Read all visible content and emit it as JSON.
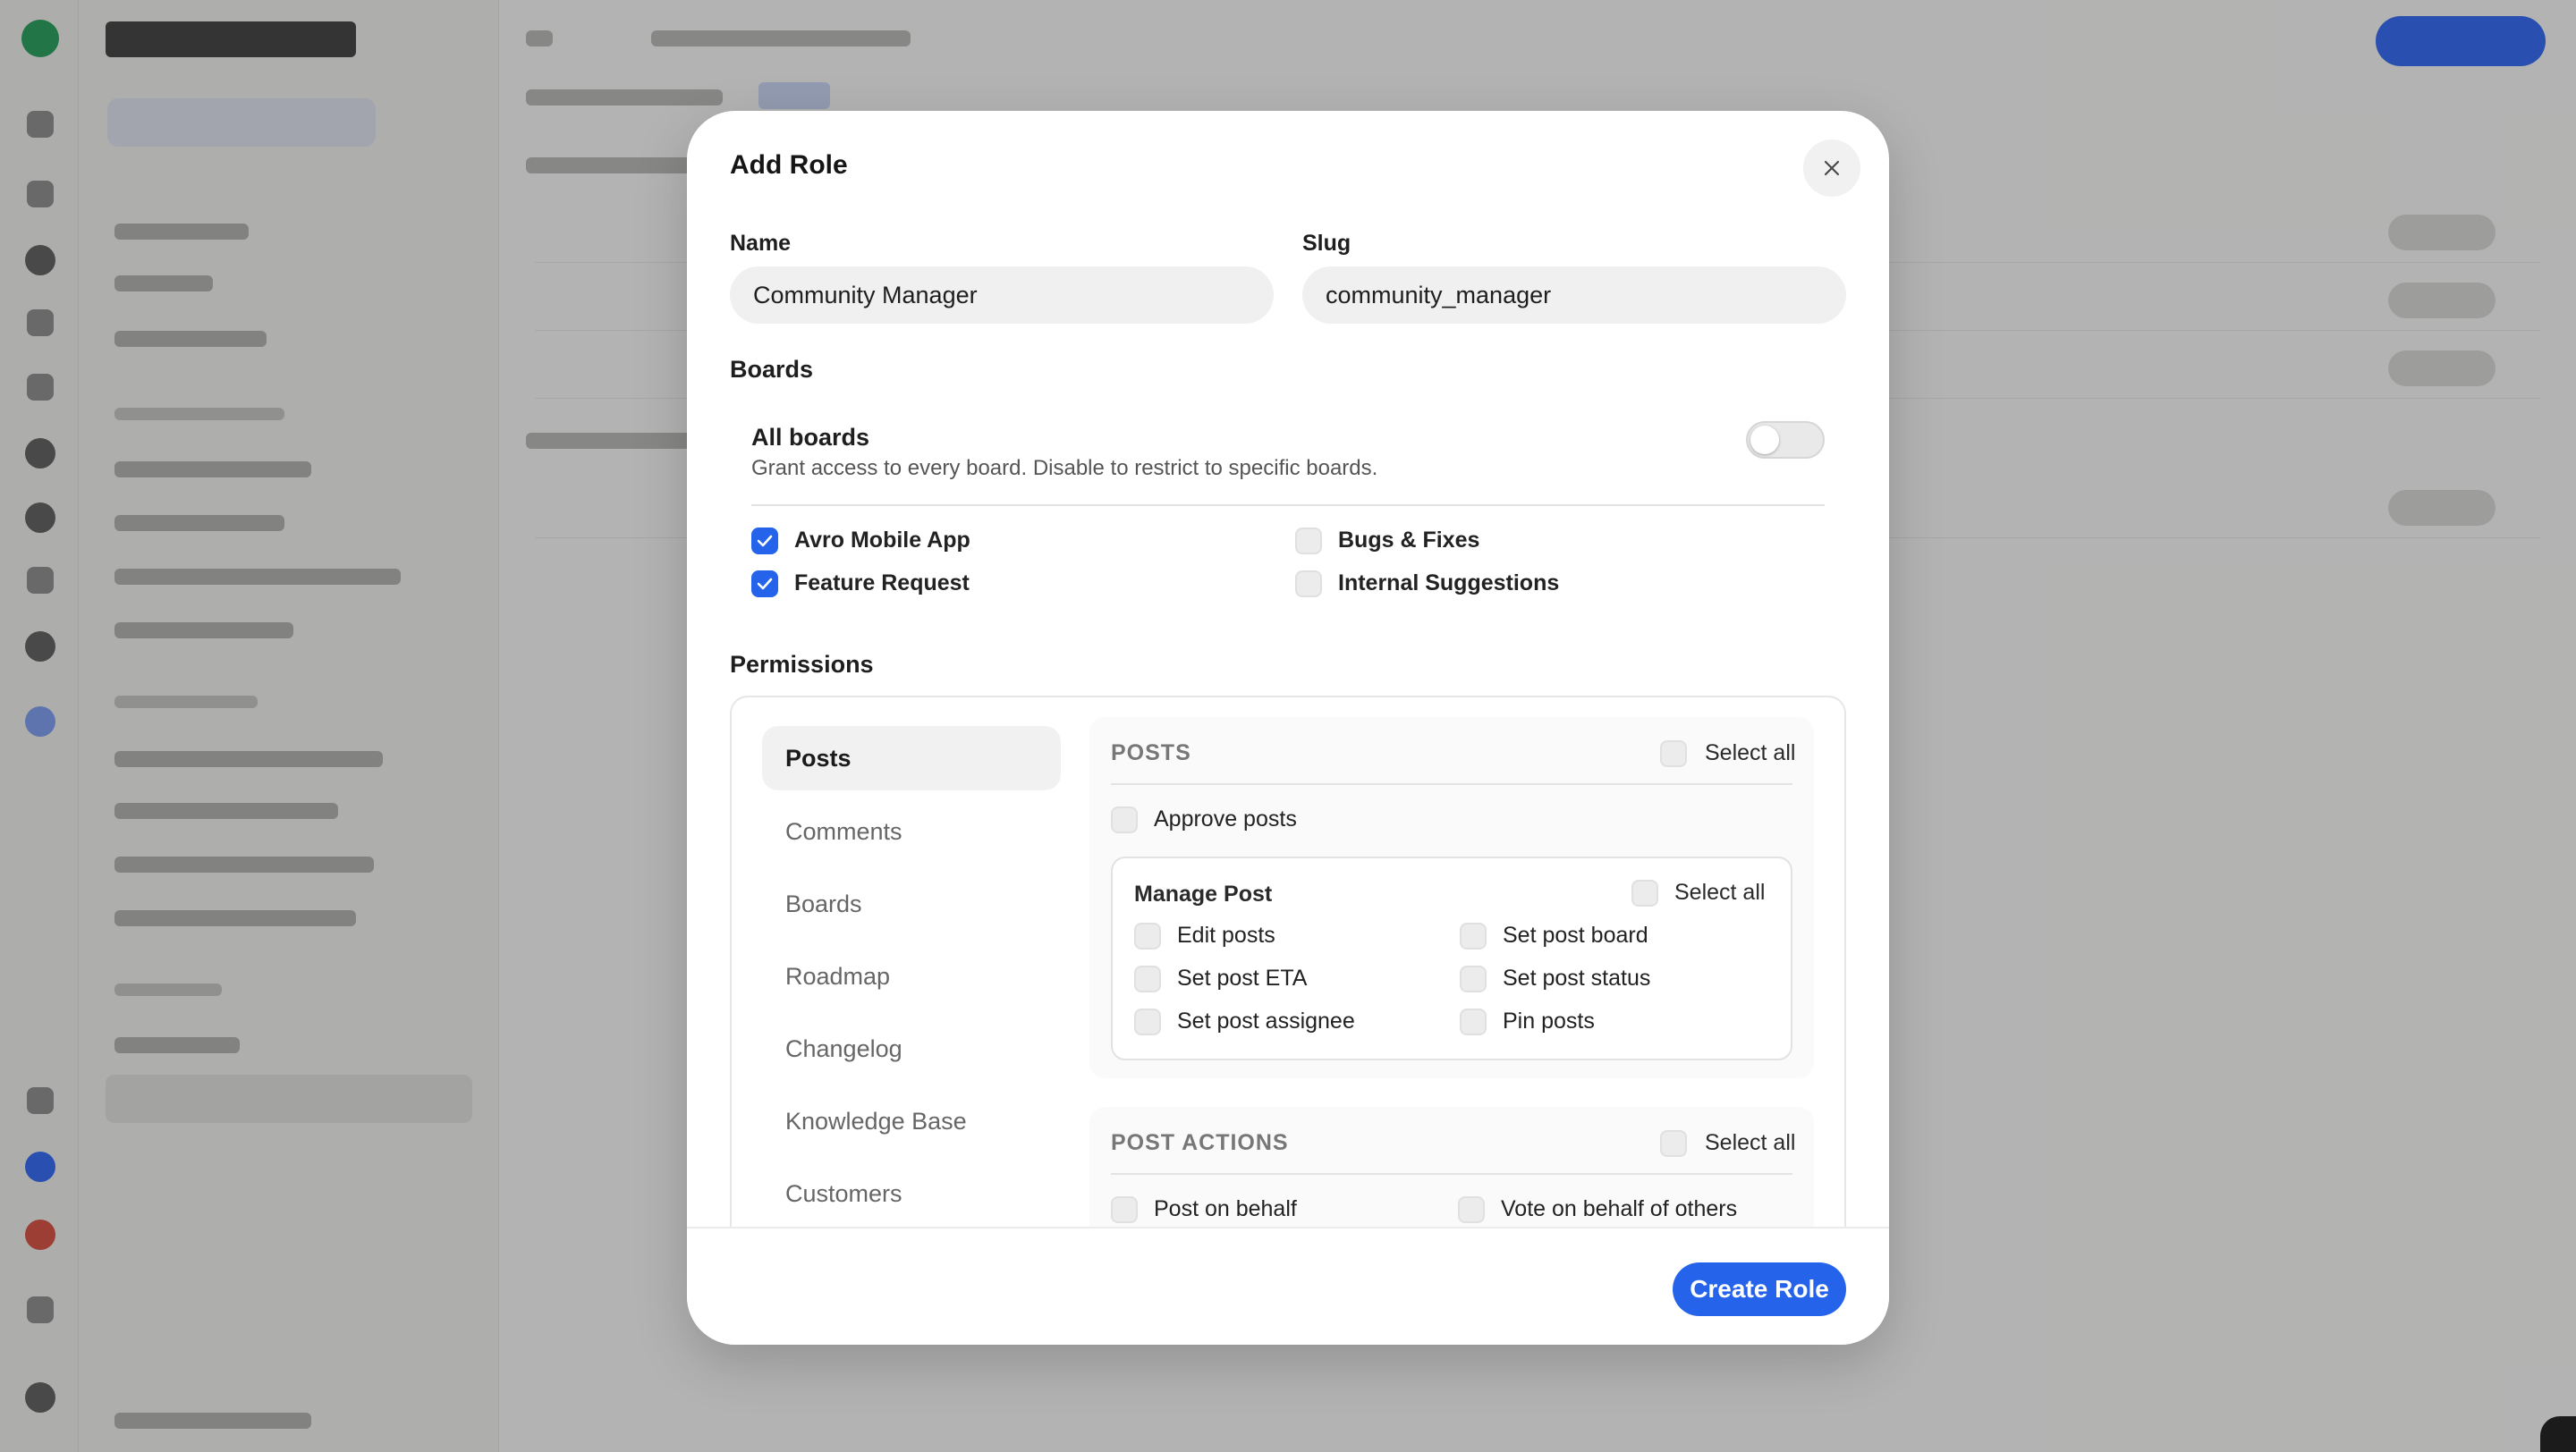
{
  "modal": {
    "title": "Add Role",
    "close_icon": "close-icon",
    "name_label": "Name",
    "name_value": "Community Manager",
    "slug_label": "Slug",
    "slug_value": "community_manager",
    "boards_label": "Boards",
    "all_boards": {
      "title": "All boards",
      "description": "Grant access to every board. Disable to restrict to specific boards.",
      "enabled": false
    },
    "boards": [
      {
        "label": "Avro Mobile App",
        "checked": true
      },
      {
        "label": "Feature Request",
        "checked": true
      },
      {
        "label": "Bugs & Fixes",
        "checked": false
      },
      {
        "label": "Internal Suggestions",
        "checked": false
      }
    ],
    "permissions_label": "Permissions",
    "perm_nav": [
      "Posts",
      "Comments",
      "Boards",
      "Roadmap",
      "Changelog",
      "Knowledge Base",
      "Customers"
    ],
    "perm_nav_active": "Posts",
    "posts_group": {
      "header": "POSTS",
      "select_all": "Select all",
      "approve": "Approve posts",
      "manage_post": {
        "title": "Manage Post",
        "select_all": "Select all",
        "items": [
          "Edit posts",
          "Set post board",
          "Set post ETA",
          "Set post status",
          "Set post assignee",
          "Pin posts"
        ]
      }
    },
    "post_actions_group": {
      "header": "POST ACTIONS",
      "select_all": "Select all",
      "items": [
        "Post on behalf",
        "Vote on behalf of others"
      ]
    },
    "create_button": "Create Role"
  },
  "colors": {
    "accent": "#2563eb",
    "overlay": "#3a3a3a"
  }
}
